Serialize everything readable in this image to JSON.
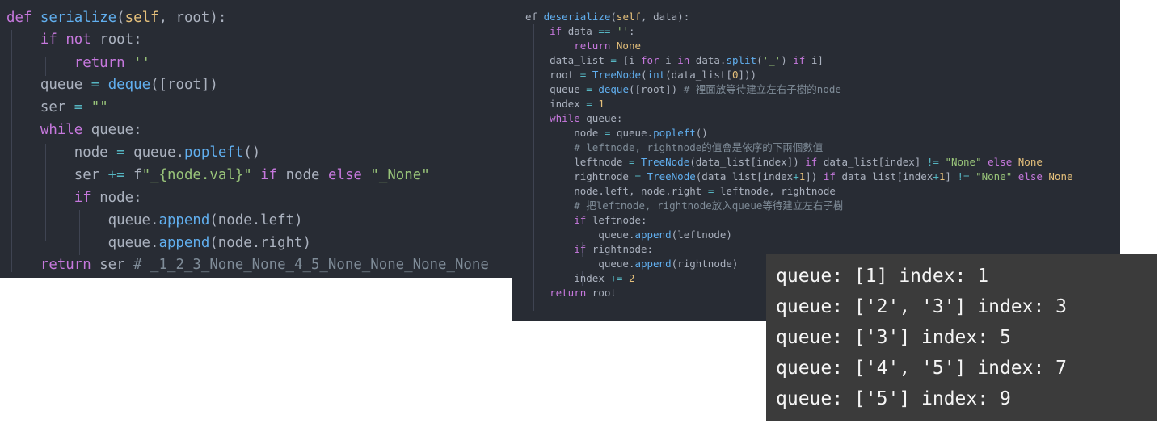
{
  "serialize_panel": {
    "lines": [
      "def serialize(self, root):",
      "    if not root:",
      "        return ''",
      "    queue = deque([root])",
      "    ser = \"\"",
      "    while queue:",
      "        node = queue.popleft()",
      "        ser += f\"_{node.val}\" if node else \"_None\"",
      "        if node:",
      "            queue.append(node.left)",
      "            queue.append(node.right)",
      "    return ser # _1_2_3_None_None_4_5_None_None_None_None"
    ]
  },
  "deserialize_panel": {
    "lines": [
      "ef deserialize(self, data):",
      "    if data == '':",
      "        return None",
      "    data_list = [i for i in data.split('_') if i]",
      "    root = TreeNode(int(data_list[0]))",
      "    queue = deque([root]) # 裡面放等待建立左右子樹的node",
      "    index = 1",
      "    while queue:",
      "        node = queue.popleft()",
      "        # leftnode, rightnode的值會是依序的下兩個數值",
      "        leftnode = TreeNode(data_list[index]) if data_list[index] != \"None\" else None",
      "        rightnode = TreeNode(data_list[index+1]) if data_list[index+1] != \"None\" else None",
      "        node.left, node.right = leftnode, rightnode",
      "        # 把leftnode, rightnode放入queue等待建立左右子樹",
      "        if leftnode:",
      "            queue.append(leftnode)",
      "        if rightnode:",
      "            queue.append(rightnode)",
      "        index += 2",
      "    return root"
    ]
  },
  "output_panel": {
    "lines": [
      "queue: [1] index: 1",
      "queue: ['2', '3'] index: 3",
      "queue: ['3'] index: 5",
      "queue: ['4', '5'] index: 7",
      "queue: ['5'] index: 9"
    ]
  }
}
